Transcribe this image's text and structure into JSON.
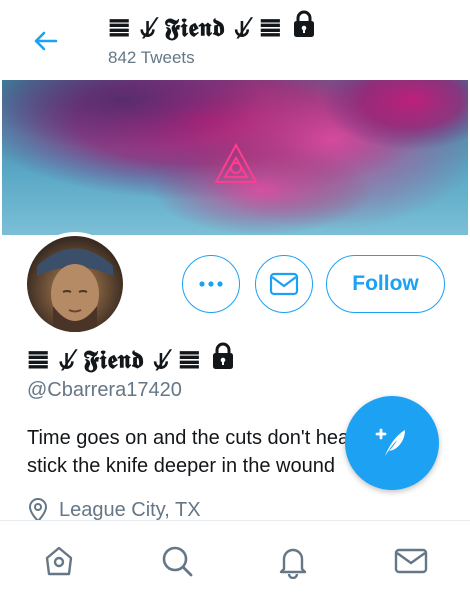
{
  "header": {
    "back_icon": "back-arrow-icon",
    "title": "𝌆 ⫝̸ 𝕱𝖎𝖊𝖓𝖉 ⫝̸ 𝌆",
    "tweet_count": "842 Tweets",
    "protected_icon": "lock-icon"
  },
  "profile": {
    "display_name": "𝌆 ⫝̸ 𝕱𝖎𝖊𝖓𝖉 ⫝̸ 𝌆",
    "handle": "@Cbarrera17420",
    "bio_lines": [
      "Time goes on and the cuts don't heal",
      "stick the knife deeper in the wound"
    ],
    "location": "League City, TX"
  },
  "actions": {
    "more_icon": "more-icon",
    "message_icon": "mail-icon",
    "follow_label": "Follow",
    "compose_icon": "compose-tweet-icon"
  },
  "nav": {
    "items": [
      "home-icon",
      "search-icon",
      "notifications-icon",
      "messages-icon"
    ]
  },
  "colors": {
    "accent": "#1da1f2",
    "secondary_text": "#657786"
  }
}
